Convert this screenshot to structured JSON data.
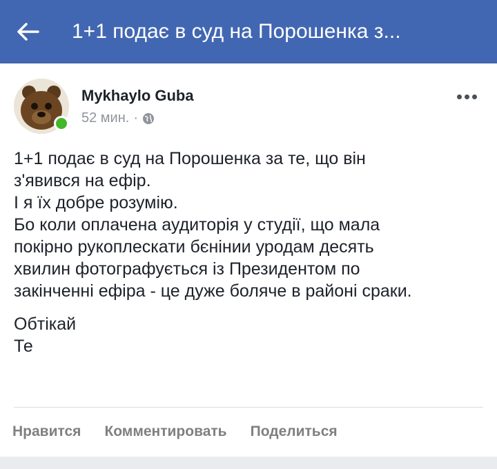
{
  "topbar": {
    "back_icon": "arrow-left-icon",
    "title": "1+1 подає в суд на Порошенка з..."
  },
  "post": {
    "author": "Mykhaylo Guba",
    "time": "52 мин.",
    "separator": "·",
    "privacy_icon": "globe-icon",
    "online_color": "#42b72a",
    "lines": [
      "1+1 подає в суд на Порошенка за те, що він",
      "з'явився на ефір.",
      "І я їх добре розумію.",
      "Бо коли оплачена аудиторія у студії, що мала",
      "покірно рукоплескати бєнінии уродам десять",
      "хвилин фотографується із Президентом по",
      "закінченні ефіра - це дуже боляче в районі сраки."
    ],
    "signoff": [
      "Обтікай",
      "Те"
    ]
  },
  "actions": {
    "like": "Нравится",
    "comment": "Комментировать",
    "share": "Поделиться"
  },
  "colors": {
    "brand": "#4267b2",
    "text": "#1d2129",
    "muted": "#90949c"
  }
}
